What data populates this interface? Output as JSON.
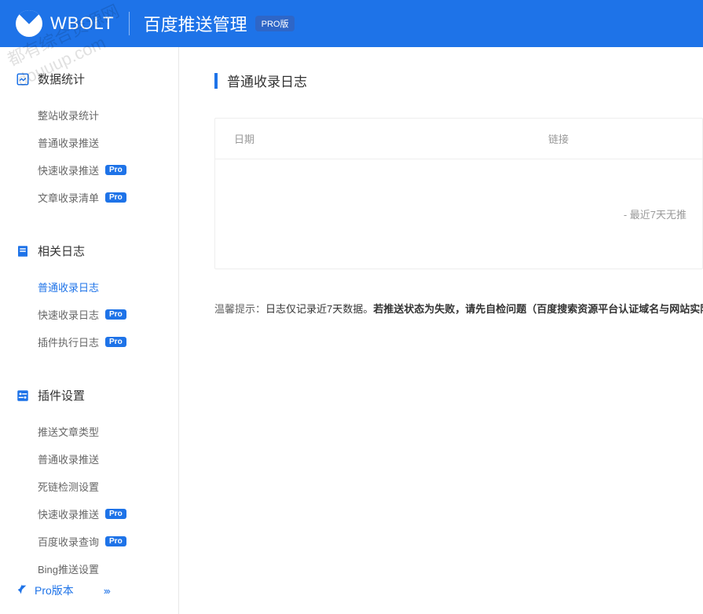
{
  "header": {
    "logo_text": "WBOLT",
    "title": "百度推送管理",
    "badge": "PRO版"
  },
  "sidebar": {
    "sections": [
      {
        "title": "数据统计",
        "icon": "chart",
        "items": [
          {
            "label": "整站收录统计",
            "pro": false,
            "active": false
          },
          {
            "label": "普通收录推送",
            "pro": false,
            "active": false
          },
          {
            "label": "快速收录推送",
            "pro": true,
            "active": false
          },
          {
            "label": "文章收录清单",
            "pro": true,
            "active": false
          }
        ]
      },
      {
        "title": "相关日志",
        "icon": "document",
        "items": [
          {
            "label": "普通收录日志",
            "pro": false,
            "active": true
          },
          {
            "label": "快速收录日志",
            "pro": true,
            "active": false
          },
          {
            "label": "插件执行日志",
            "pro": true,
            "active": false
          }
        ]
      },
      {
        "title": "插件设置",
        "icon": "settings",
        "items": [
          {
            "label": "推送文章类型",
            "pro": false,
            "active": false
          },
          {
            "label": "普通收录推送",
            "pro": false,
            "active": false
          },
          {
            "label": "死链检测设置",
            "pro": false,
            "active": false
          },
          {
            "label": "快速收录推送",
            "pro": true,
            "active": false
          },
          {
            "label": "百度收录查询",
            "pro": true,
            "active": false
          },
          {
            "label": "Bing推送设置",
            "pro": false,
            "active": false
          }
        ]
      }
    ],
    "footer": {
      "label": "Pro版本",
      "arrows": "›››"
    }
  },
  "main": {
    "page_title": "普通收录日志",
    "table": {
      "col_date": "日期",
      "col_link": "链接",
      "empty_text": "- 最近7天无推"
    },
    "tip_label": "温馨提示：",
    "tip_text1": "日志仅记录近7天数据。",
    "tip_text2": "若推送状态为失败，请先自检问题（百度搜索资源平台认证域名与网站实际"
  },
  "pro_badge": "Pro",
  "watermark": {
    "line1": "都有综合资源网",
    "line2": "douuup.com"
  }
}
